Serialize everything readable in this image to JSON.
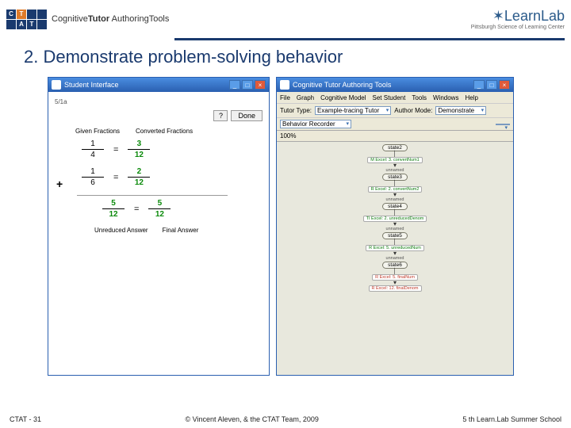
{
  "header": {
    "ctat_letters": [
      "C",
      "T",
      "A",
      "T"
    ],
    "ctat_label_a": "Cognitive",
    "ctat_label_b": "Tutor",
    "ctat_label_c": "AuthoringTools",
    "learnlab": "LearnLab",
    "learnlab_sub": "Pittsburgh Science of Learning Center"
  },
  "slide_title": "2. Demonstrate problem-solving behavior",
  "student_win": {
    "title": "Student Interface",
    "sub": "5/1a",
    "hint_btn": "?",
    "done_btn": "Done",
    "col1": "Given Fractions",
    "col2": "Converted Fractions",
    "rows": [
      {
        "n1": "1",
        "d1": "4",
        "n2": "3",
        "d2": "12"
      },
      {
        "n1": "1",
        "d1": "6",
        "n2": "2",
        "d2": "12"
      }
    ],
    "sum": {
      "n1": "5",
      "d1": "12",
      "n2": "5",
      "d2": "12"
    },
    "lab1": "Unreduced Answer",
    "lab2": "Final Answer"
  },
  "ctat_win": {
    "title": "Cognitive Tutor Authoring Tools",
    "menus": [
      "File",
      "Graph",
      "Cognitive Model",
      "Set Student",
      "Tools",
      "Windows",
      "Help"
    ],
    "tutor_type_label": "Tutor Type:",
    "tutor_type_val": "Example-tracing Tutor",
    "author_mode_label": "Author Mode:",
    "author_mode_val": "Demonstrate",
    "recorder": "Behavior Recorder",
    "zoom": "100%",
    "nodes": [
      "state2",
      "state3",
      "state4",
      "state5",
      "state6"
    ],
    "edges": [
      "M Excel: 3. convertNum1",
      "R Excel: 2. convertNum2",
      "TI Excel: 2. unreducedDenom",
      "R Excel: 5. unreducedNum",
      "R Excel: 5. finalNum",
      "R Excel: 12. finalDenom"
    ],
    "unnamed": "unnamed"
  },
  "footer": {
    "left": "CTAT - 31",
    "center": "© Vincent Aleven, & the CTAT Team, 2009",
    "right": "5 th Learn.Lab Summer School"
  }
}
